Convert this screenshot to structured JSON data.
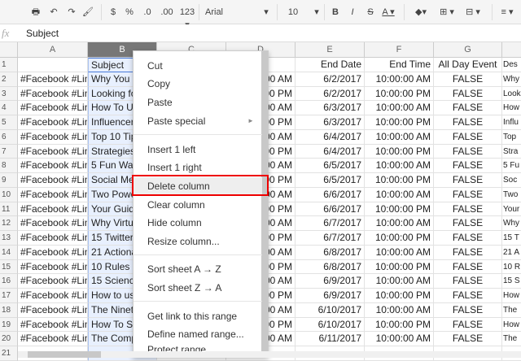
{
  "toolbar": {
    "items": [
      {
        "name": "print-icon",
        "g": "🖶"
      },
      {
        "name": "undo-icon",
        "g": "↶"
      },
      {
        "name": "redo-icon",
        "g": "↷"
      },
      {
        "name": "paint-format-icon",
        "g": "🖌"
      },
      {
        "name": "currency-button",
        "g": "$"
      },
      {
        "name": "percent-button",
        "g": "%"
      },
      {
        "name": "decrease-decimal-button",
        "g": ".0"
      },
      {
        "name": "increase-decimal-button",
        "g": ".00"
      },
      {
        "name": "more-formats-button",
        "g": "123 ▾"
      },
      {
        "name": "font-select",
        "g": "Arial"
      },
      {
        "name": "font-chevron-icon",
        "g": "▾"
      },
      {
        "name": "font-size-select",
        "g": "10"
      },
      {
        "name": "font-size-chevron-icon",
        "g": "▾"
      },
      {
        "name": "bold-button",
        "g": "B"
      },
      {
        "name": "italic-button",
        "g": "I"
      },
      {
        "name": "strikethrough-button",
        "g": "S"
      },
      {
        "name": "text-color-button",
        "g": "A ▾"
      },
      {
        "name": "fill-color-icon",
        "g": "◆▾"
      },
      {
        "name": "borders-icon",
        "g": "⊞ ▾"
      },
      {
        "name": "merge-icon",
        "g": "⊟ ▾"
      },
      {
        "name": "align-icon",
        "g": "≡ ▾"
      }
    ]
  },
  "formula_bar": {
    "fx": "fx",
    "value": "Subject"
  },
  "columns": [
    "A",
    "B",
    "C",
    "D",
    "E",
    "F",
    "G"
  ],
  "selected_column": "B",
  "header_row": [
    "",
    "Subject",
    "",
    "",
    "End Date",
    "End Time",
    "All Day Event",
    "Des"
  ],
  "rows": [
    [
      "#Facebook #Link",
      "Why You ar",
      "",
      "00 AM",
      "6/2/2017",
      "10:00:00 AM",
      "FALSE",
      "Why"
    ],
    [
      "#Facebook #Link",
      "Looking for",
      "",
      "00 PM",
      "6/2/2017",
      "10:00:00 PM",
      "FALSE",
      "Look"
    ],
    [
      "#Facebook #Link",
      "How To Use",
      "",
      "00 AM",
      "6/3/2017",
      "10:00:00 AM",
      "FALSE",
      "How"
    ],
    [
      "#Facebook #Link",
      "Influencer M",
      "",
      "00 PM",
      "6/3/2017",
      "10:00:00 PM",
      "FALSE",
      "Influ"
    ],
    [
      "#Facebook #Link",
      "Top 10 Tips",
      "",
      "00 AM",
      "6/4/2017",
      "10:00:00 AM",
      "FALSE",
      "Top"
    ],
    [
      "#Facebook #Link",
      "Strategies f",
      "",
      "00 PM",
      "6/4/2017",
      "10:00:00 PM",
      "FALSE",
      "Stra"
    ],
    [
      "#Facebook #Link",
      "5 Fun Ways",
      "",
      "00 AM",
      "6/5/2017",
      "10:00:00 AM",
      "FALSE",
      "5 Fu"
    ],
    [
      "#Facebook #Link",
      "Social Med",
      "",
      "00 PM",
      "6/5/2017",
      "10:00:00 PM",
      "FALSE",
      "Soc"
    ],
    [
      "#Facebook #Link",
      "Two Power",
      "",
      "00 AM",
      "6/6/2017",
      "10:00:00 AM",
      "FALSE",
      "Two"
    ],
    [
      "#Facebook #Link",
      "Your Guide",
      "",
      "00 PM",
      "6/6/2017",
      "10:00:00 PM",
      "FALSE",
      "Your"
    ],
    [
      "#Facebook #Link",
      "Why Virtual",
      "",
      "00 AM",
      "6/7/2017",
      "10:00:00 AM",
      "FALSE",
      "Why"
    ],
    [
      "#Facebook #Link",
      "15 Twitter T",
      "",
      "00 PM",
      "6/7/2017",
      "10:00:00 PM",
      "FALSE",
      "15 T"
    ],
    [
      "#Facebook #Link",
      "21 Actionab",
      "",
      "00 AM",
      "6/8/2017",
      "10:00:00 AM",
      "FALSE",
      "21 A"
    ],
    [
      "#Facebook #Link",
      "10 Rules O",
      "",
      "00 PM",
      "6/8/2017",
      "10:00:00 PM",
      "FALSE",
      "10 R"
    ],
    [
      "#Facebook #Link",
      "15 Science",
      "",
      "00 AM",
      "6/9/2017",
      "10:00:00 AM",
      "FALSE",
      "15 S"
    ],
    [
      "#Facebook #Link",
      "How to use",
      "",
      "00 PM",
      "6/9/2017",
      "10:00:00 PM",
      "FALSE",
      "How"
    ],
    [
      "#Facebook #Link",
      "The Ninetee",
      "",
      "00 AM",
      "6/10/2017",
      "10:00:00 AM",
      "FALSE",
      "The"
    ],
    [
      "#Facebook #Link",
      "How To Stre",
      "",
      "00 PM",
      "6/10/2017",
      "10:00:00 PM",
      "FALSE",
      "How"
    ],
    [
      "#Facebook #Link",
      "The Comple",
      "",
      "00 AM",
      "6/11/2017",
      "10:00:00 AM",
      "FALSE",
      "The"
    ]
  ],
  "context_menu": {
    "items": [
      "Cut",
      "Copy",
      "Paste",
      "Paste special",
      "Insert 1 left",
      "Insert 1 right",
      "Delete column",
      "Clear column",
      "Hide column",
      "Resize column...",
      "Sort sheet A → Z",
      "Sort sheet Z → A",
      "Get link to this range",
      "Define named range...",
      "Protect range..."
    ],
    "submenu_arrow": "►",
    "highlighted": "Delete column",
    "highlight_box_color": "#e00000"
  }
}
